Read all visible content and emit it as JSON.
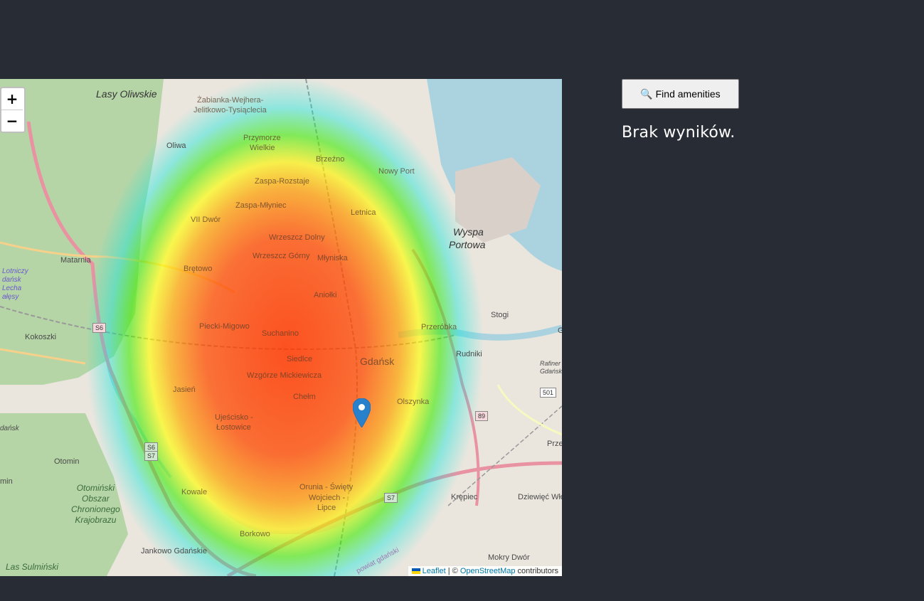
{
  "map": {
    "zoom_in": "+",
    "zoom_out": "−",
    "labels": {
      "lasy_oliwskie": "Lasy Oliwskie",
      "zabianka": "Żabianka-Wejhera-",
      "jelitkowo": "Jelitkowo-Tysiąclecia",
      "oliwa": "Oliwa",
      "przymorze1": "Przymorze",
      "przymorze2": "Wielkie",
      "brzezno": "Brzeźno",
      "nowy_port": "Nowy Port",
      "zaspa_rozstaje": "Zaspa-Rozstaje",
      "zaspa_mlyniec": "Zaspa-Młyniec",
      "vii_dwor": "VII Dwór",
      "letnica": "Letnica",
      "wyspa1": "Wyspa",
      "wyspa2": "Portowa",
      "wrzeszcz_dolny": "Wrzeszcz Dolny",
      "wrzeszcz_gorny": "Wrzeszcz Górny",
      "mlyniska": "Młyniska",
      "matarnia": "Matarnia",
      "bretowo": "Brętowo",
      "lotnisko1": "Lotniczy",
      "lotnisko2": "dańsk",
      "lotnisko3": "Lecha",
      "lotnisko4": "ałęsy",
      "aniolki": "Aniołki",
      "stogi": "Stogi",
      "kokoszki": "Kokoszki",
      "piecki": "Piecki-Migowo",
      "suchanino": "Suchanino",
      "przerobka": "Przeróbka",
      "gdansk": "Gdańsk",
      "rudniki": "Rudniki",
      "siedlce": "Siedlce",
      "wzgorze": "Wzgórze Mickiewicza",
      "rafineria1": "Rafiner",
      "rafineria2": "Gdańsk",
      "jasien": "Jasień",
      "chelm": "Chełm",
      "olszynka": "Olszynka",
      "ujescisko1": "Ujeścisko -",
      "ujescisko2": "Łostowice",
      "otomin": "Otomin",
      "otominski1": "Otomiński",
      "otominski2": "Obszar",
      "otominski3": "Chronionego",
      "otominski4": "Krajobrazu",
      "kowale": "Kowale",
      "orunia1": "Orunia - Święty",
      "orunia2": "Wojciech -",
      "orunia3": "Lipce",
      "krepiec": "Krępiec",
      "dziewiec": "Dziewięć Włó",
      "borkowo": "Borkowo",
      "jankowo": "Jankowo Gdańskie",
      "mokry_dwor": "Mokry Dwór",
      "las_sulminski": "Las Sulmiński",
      "powiat": "powiat gdański",
      "dansk_left": "dańsk",
      "min_left": "min",
      "prze_right": "Prze",
      "g_right": "G"
    },
    "shields": {
      "s6_top": "S6",
      "s6_bottom": "S6",
      "s7_bottom": "S7",
      "s7_mid": "S7",
      "r89": "89",
      "r501": "501"
    },
    "attribution": {
      "leaflet": "Leaflet",
      "separator": " | © ",
      "osm": "OpenStreetMap",
      "suffix": " contributors"
    }
  },
  "sidebar": {
    "find_button": "🔍 Find amenities",
    "status_text": "Brak wyników."
  }
}
